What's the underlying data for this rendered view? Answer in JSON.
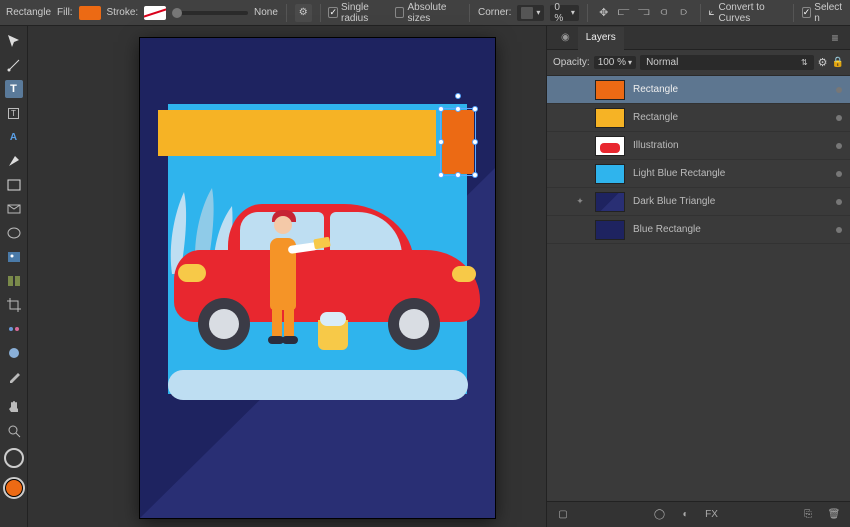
{
  "topbar": {
    "shape_label": "Rectangle",
    "fill_label": "Fill:",
    "fill_color": "#ec6a14",
    "stroke_label": "Stroke:",
    "stroke_none": "None",
    "single_radius_label": "Single radius",
    "absolute_sizes_label": "Absolute sizes",
    "corner_label": "Corner:",
    "corner_value": "0 %",
    "convert_label": "Convert to Curves",
    "select_label": "Select n"
  },
  "panel": {
    "tab_label": "Layers",
    "opacity_label": "Opacity:",
    "opacity_value": "100 %",
    "blend_mode": "Normal",
    "layers": [
      {
        "name": "Rectangle",
        "thumb": "orange",
        "selected": true,
        "pre": ""
      },
      {
        "name": "Rectangle",
        "thumb": "yellow",
        "selected": false,
        "pre": ""
      },
      {
        "name": "Illustration",
        "thumb": "illus",
        "selected": false,
        "pre": "</>"
      },
      {
        "name": "Light Blue Rectangle",
        "thumb": "lblue",
        "selected": false,
        "pre": ""
      },
      {
        "name": "Dark Blue Triangle",
        "thumb": "dblue",
        "selected": false,
        "pre": "✦"
      },
      {
        "name": "Blue Rectangle",
        "thumb": "blue",
        "selected": false,
        "pre": ""
      }
    ],
    "footer_fx": "FX"
  },
  "colors": {
    "accent_orange": "#ec6a14",
    "accent_yellow": "#f6b325",
    "light_blue": "#2fb4ed",
    "dark_blue": "#1e2360",
    "car_red": "#e8272f"
  }
}
